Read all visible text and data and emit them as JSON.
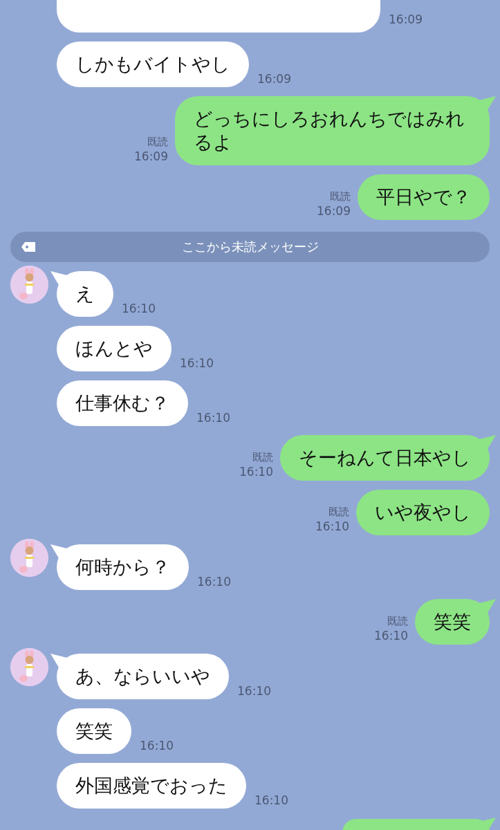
{
  "messages": [
    {
      "kind": "received_partial",
      "time": "16:09"
    },
    {
      "kind": "received",
      "text": "しかもバイトやし",
      "time": "16:09",
      "avatar": false,
      "tail": false
    },
    {
      "kind": "sent",
      "text": "どっちにしろおれんちではみれるよ",
      "read": "既読",
      "time": "16:09",
      "tail": true
    },
    {
      "kind": "sent",
      "text": "平日やで？",
      "read": "既読",
      "time": "16:09",
      "tail": false
    },
    {
      "kind": "divider",
      "text": "ここから未読メッセージ"
    },
    {
      "kind": "received",
      "text": "え",
      "time": "16:10",
      "avatar": true,
      "tail": true
    },
    {
      "kind": "received",
      "text": "ほんとや",
      "time": "16:10",
      "avatar": false,
      "tail": false
    },
    {
      "kind": "received",
      "text": "仕事休む？",
      "time": "16:10",
      "avatar": false,
      "tail": false
    },
    {
      "kind": "sent",
      "text": "そーねんて日本やし",
      "read": "既読",
      "time": "16:10",
      "tail": true
    },
    {
      "kind": "sent",
      "text": "いや夜やし",
      "read": "既読",
      "time": "16:10",
      "tail": false
    },
    {
      "kind": "received",
      "text": "何時から？",
      "time": "16:10",
      "avatar": true,
      "tail": true
    },
    {
      "kind": "sent",
      "text": "笑笑",
      "read": "既読",
      "time": "16:10",
      "tail": true
    },
    {
      "kind": "received",
      "text": "あ、ならいいや",
      "time": "16:10",
      "avatar": true,
      "tail": true
    },
    {
      "kind": "received",
      "text": "笑笑",
      "time": "16:10",
      "avatar": false,
      "tail": false
    },
    {
      "kind": "received",
      "text": "外国感覚でおった",
      "time": "16:10",
      "avatar": false,
      "tail": false
    },
    {
      "kind": "sent_partial",
      "tail": true
    }
  ]
}
